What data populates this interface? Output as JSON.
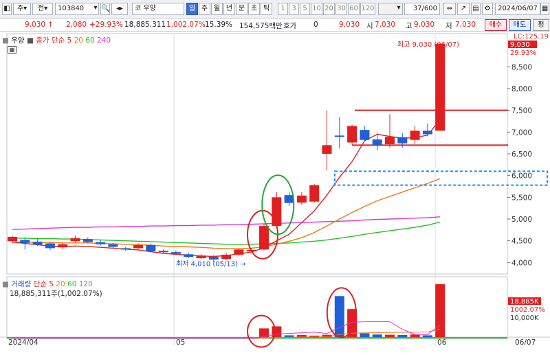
{
  "toolbar": {
    "market": "주",
    "type": "전",
    "code": "103840",
    "name": "코 우양",
    "periods": [
      "일",
      "주",
      "월",
      "년",
      "분",
      "초",
      "틱",
      "1",
      "3",
      "5",
      "10",
      "20",
      "30",
      "60",
      "120"
    ],
    "active_period": "일",
    "count": "37",
    "count_total": "/600",
    "date": "2024/06/07"
  },
  "quote": {
    "price": "9,030",
    "price_arrow": "↑",
    "change": "2,080",
    "change_pct": "+29.93%",
    "volume": "18,885,311",
    "volume_pct": "1,002.07%",
    "turnover": "15.39%",
    "trade_value": "154,575백만",
    "hoga_label": "호가",
    "hoga_value": "0",
    "hoga_price": "9,030",
    "open_label": "시",
    "open": "7,030",
    "high_label": "고",
    "high": "9,030",
    "low_label": "저",
    "low": "7,030",
    "buy": "매수",
    "sell": "매도",
    "eval": "평"
  },
  "price_legend": {
    "name": "우양",
    "ma_label": "종가 단순",
    "periods": [
      "5",
      "20",
      "60",
      "240"
    ],
    "colors": [
      "#e02020",
      "#f07a10",
      "#22c422",
      "#e030e0"
    ]
  },
  "volume_legend": {
    "label": "거래량",
    "ma_label": "단순",
    "periods": [
      "5",
      "20",
      "60",
      "120"
    ],
    "colors": [
      "#e02020",
      "#f07a10",
      "#22c422",
      "#e030e0"
    ],
    "value_text": "18,885,311주(1,002.07%)"
  },
  "annotations": {
    "high": "최고 9,030 (06/07)",
    "low": "최저 4,010 (05/13)",
    "lc_label": "LC:125.19",
    "price_tag": "9,030",
    "price_tag_pct": "29.93%",
    "vol_tag": "18,885K",
    "vol_tag_pct": "1002.07%",
    "vol_axis_mid": "10,000K"
  },
  "price_axis_ticks": [
    "8,500",
    "8,000",
    "7,500",
    "7,000",
    "6,500",
    "6,000",
    "5,500",
    "5,000",
    "4,500",
    "4,000"
  ],
  "x_axis": {
    "labels": [
      "2024/04",
      "05",
      "06"
    ],
    "end_label": "06/07"
  },
  "chart_data": {
    "type": "candlestick",
    "y_range": [
      3800,
      9200
    ],
    "candles": [
      {
        "o": 4490,
        "c": 4590,
        "h": 4620,
        "l": 4440
      },
      {
        "o": 4520,
        "c": 4450,
        "h": 4580,
        "l": 4300
      },
      {
        "o": 4480,
        "c": 4410,
        "h": 4540,
        "l": 4380
      },
      {
        "o": 4440,
        "c": 4330,
        "h": 4480,
        "l": 4290
      },
      {
        "o": 4350,
        "c": 4420,
        "h": 4460,
        "l": 4310
      },
      {
        "o": 4490,
        "c": 4560,
        "h": 4620,
        "l": 4460
      },
      {
        "o": 4540,
        "c": 4470,
        "h": 4580,
        "l": 4440
      },
      {
        "o": 4470,
        "c": 4420,
        "h": 4520,
        "l": 4390
      },
      {
        "o": 4420,
        "c": 4360,
        "h": 4450,
        "l": 4330
      },
      {
        "o": 4330,
        "c": 4300,
        "h": 4360,
        "l": 4270
      },
      {
        "o": 4330,
        "c": 4400,
        "h": 4440,
        "l": 4300
      },
      {
        "o": 4400,
        "c": 4260,
        "h": 4430,
        "l": 4240
      },
      {
        "o": 4270,
        "c": 4240,
        "h": 4300,
        "l": 4210
      },
      {
        "o": 4240,
        "c": 4200,
        "h": 4280,
        "l": 4170
      },
      {
        "o": 4190,
        "c": 4130,
        "h": 4230,
        "l": 4100
      },
      {
        "o": 4100,
        "c": 4160,
        "h": 4200,
        "l": 4080
      },
      {
        "o": 4130,
        "c": 4070,
        "h": 4170,
        "l": 4010
      },
      {
        "o": 4080,
        "c": 4180,
        "h": 4220,
        "l": 4060
      },
      {
        "o": 4180,
        "c": 4300,
        "h": 4330,
        "l": 4150
      },
      {
        "o": 4270,
        "c": 4290,
        "h": 4340,
        "l": 4240
      },
      {
        "o": 4300,
        "c": 4840,
        "h": 4880,
        "l": 4280
      },
      {
        "o": 4840,
        "c": 5500,
        "h": 5620,
        "l": 4800
      },
      {
        "o": 5550,
        "c": 5370,
        "h": 5620,
        "l": 5300
      },
      {
        "o": 5380,
        "c": 5540,
        "h": 5620,
        "l": 5330
      },
      {
        "o": 5400,
        "c": 5780,
        "h": 5800,
        "l": 5380
      },
      {
        "o": 6500,
        "c": 6700,
        "h": 7500,
        "l": 6120
      },
      {
        "o": 6920,
        "c": 6890,
        "h": 7350,
        "l": 6620
      },
      {
        "o": 6760,
        "c": 7140,
        "h": 7170,
        "l": 6700
      },
      {
        "o": 7050,
        "c": 6820,
        "h": 7140,
        "l": 6780
      },
      {
        "o": 6830,
        "c": 6700,
        "h": 6990,
        "l": 6580
      },
      {
        "o": 6720,
        "c": 6890,
        "h": 7410,
        "l": 6640
      },
      {
        "o": 6880,
        "c": 6740,
        "h": 6980,
        "l": 6640
      },
      {
        "o": 6820,
        "c": 7030,
        "h": 7140,
        "l": 6720
      },
      {
        "o": 7030,
        "c": 6950,
        "h": 7200,
        "l": 6900
      },
      {
        "o": 7030,
        "c": 9030,
        "h": 9030,
        "l": 7030
      }
    ],
    "volume_max": 20000,
    "volumes": [
      0,
      0,
      0,
      0,
      0,
      0,
      0,
      0,
      0,
      0,
      0,
      0,
      0,
      0,
      0,
      0,
      0,
      0,
      0,
      0,
      3500,
      4200,
      1100,
      1200,
      1000,
      1300,
      14700,
      10200,
      1800,
      1400,
      1300,
      1200,
      1400,
      1100,
      18885
    ],
    "ma5": [
      4470,
      4440,
      4410,
      4380,
      4360,
      4380,
      4370,
      4350,
      4330,
      4310,
      4290,
      4250,
      4210,
      4190,
      4170,
      4150,
      4140,
      4160,
      4200,
      4240,
      4340,
      4500,
      4650,
      4920,
      5190,
      5550,
      5960,
      6320,
      6800,
      6950,
      6900,
      6860,
      6870,
      6930,
      7280
    ],
    "ma20": [
      4470,
      4470,
      4460,
      4460,
      4450,
      4450,
      4450,
      4440,
      4430,
      4420,
      4410,
      4400,
      4380,
      4370,
      4360,
      4350,
      4330,
      4320,
      4320,
      4330,
      4360,
      4420,
      4490,
      4570,
      4690,
      4840,
      5000,
      5150,
      5290,
      5420,
      5520,
      5620,
      5720,
      5820,
      5930
    ],
    "ma60": [
      4560,
      4560,
      4550,
      4550,
      4540,
      4540,
      4530,
      4520,
      4510,
      4500,
      4490,
      4480,
      4470,
      4460,
      4450,
      4440,
      4430,
      4420,
      4420,
      4420,
      4430,
      4440,
      4450,
      4470,
      4490,
      4520,
      4560,
      4600,
      4650,
      4690,
      4730,
      4770,
      4810,
      4860,
      4930
    ],
    "ma240": [
      4760,
      4770,
      4780,
      4790,
      4800,
      4810,
      4810,
      4820,
      4820,
      4830,
      4830,
      4840,
      4840,
      4850,
      4850,
      4860,
      4860,
      4870,
      4870,
      4880,
      4890,
      4900,
      4910,
      4920,
      4930,
      4940,
      4950,
      4960,
      4980,
      4990,
      5000,
      5010,
      5020,
      5030,
      5050
    ],
    "vol_ma5": [
      0,
      0,
      0,
      0,
      0,
      0,
      0,
      0,
      0,
      0,
      0,
      0,
      0,
      0,
      0,
      0,
      0,
      0,
      0,
      0,
      700,
      1540,
      1760,
      2000,
      2200,
      1760,
      3760,
      5700,
      5800,
      5900,
      5800,
      3200,
      1400,
      1300,
      4780
    ],
    "vol_ma20": [
      0,
      0,
      0,
      0,
      0,
      0,
      0,
      0,
      0,
      0,
      0,
      0,
      0,
      0,
      0,
      0,
      0,
      0,
      0,
      0,
      175,
      385,
      440,
      500,
      550,
      615,
      1350,
      1860,
      1950,
      2020,
      2085,
      2145,
      2215,
      2270,
      3210
    ]
  },
  "levels": {
    "resistance": 7500,
    "support": 6700,
    "box_top": 6100,
    "box_bottom": 5780
  }
}
